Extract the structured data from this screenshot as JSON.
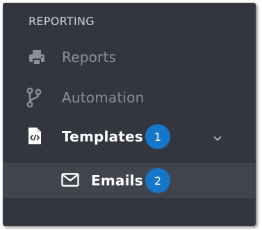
{
  "section": {
    "title": "REPORTING"
  },
  "nav": {
    "items": [
      {
        "label": "Reports",
        "icon": "printer-icon"
      },
      {
        "label": "Automation",
        "icon": "branch-icon"
      },
      {
        "label": "Templates",
        "icon": "code-file-icon",
        "badge": "1",
        "expanded": true
      }
    ],
    "subitems": [
      {
        "label": "Emails",
        "icon": "envelope-icon",
        "badge": "2"
      }
    ]
  },
  "colors": {
    "panel": "#33363f",
    "active_row": "#41444d",
    "badge": "#1676c7"
  }
}
